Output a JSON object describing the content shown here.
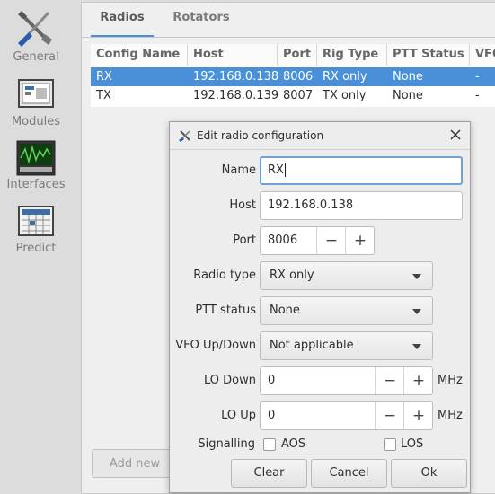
{
  "sidebar": {
    "items": [
      {
        "label": "General",
        "icon": "wrench-screwdriver-icon"
      },
      {
        "label": "Modules",
        "icon": "modules-icon"
      },
      {
        "label": "Interfaces",
        "icon": "oscilloscope-icon"
      },
      {
        "label": "Predict",
        "icon": "calendar-grid-icon"
      }
    ]
  },
  "tabs": [
    {
      "label": "Radios",
      "active": true
    },
    {
      "label": "Rotators",
      "active": false
    }
  ],
  "table": {
    "columns": [
      "Config Name",
      "Host",
      "Port",
      "Rig Type",
      "PTT Status",
      "VFO"
    ],
    "rows": [
      {
        "name": "RX",
        "host": "192.168.0.138",
        "port": "8006",
        "rig_type": "RX only",
        "ptt": "None",
        "vfo": "-",
        "selected": true
      },
      {
        "name": "TX",
        "host": "192.168.0.139",
        "port": "8007",
        "rig_type": "TX only",
        "ptt": "None",
        "vfo": "-",
        "selected": false
      }
    ]
  },
  "add_new_label": "Add new",
  "dialog": {
    "title": "Edit radio configuration",
    "name_label": "Name",
    "name_value": "RX",
    "host_label": "Host",
    "host_value": "192.168.0.138",
    "port_label": "Port",
    "port_value": "8006",
    "radio_type_label": "Radio type",
    "radio_type_value": "RX only",
    "ptt_label": "PTT status",
    "ptt_value": "None",
    "vfo_label": "VFO Up/Down",
    "vfo_value": "Not applicable",
    "lo_down_label": "LO Down",
    "lo_down_value": "0",
    "lo_up_label": "LO Up",
    "lo_up_value": "0",
    "unit": "MHz",
    "signalling_label": "Signalling",
    "aos_label": "AOS",
    "los_label": "LOS",
    "minus": "−",
    "plus": "+",
    "clear_label": "Clear",
    "cancel_label": "Cancel",
    "ok_label": "Ok"
  },
  "colors": {
    "selection": "#4a90d9",
    "focus": "#6fa0d6"
  }
}
